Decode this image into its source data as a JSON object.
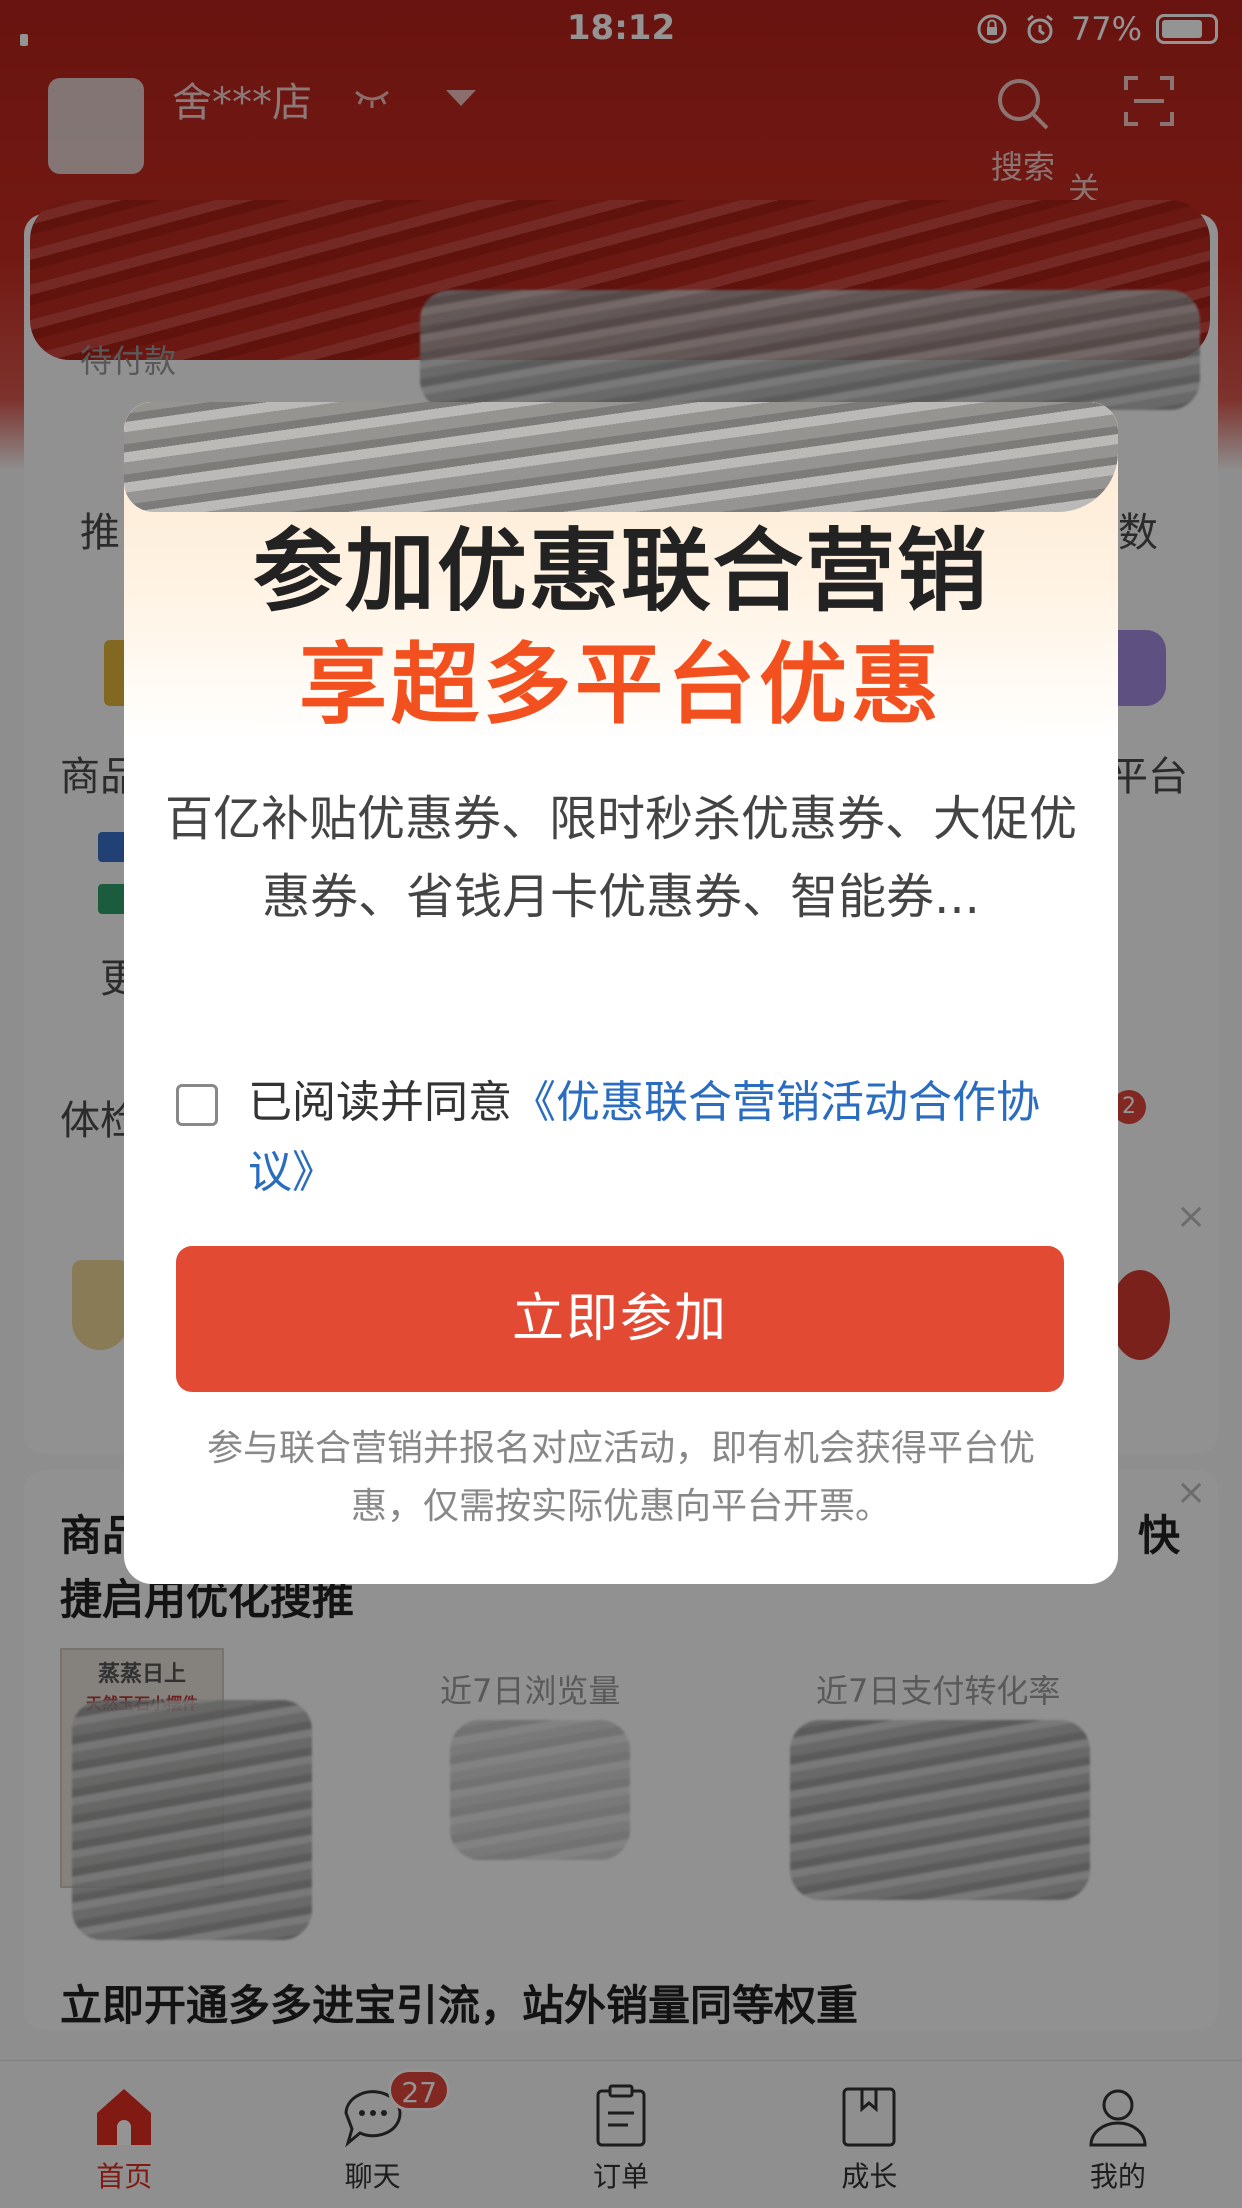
{
  "status_bar": {
    "time": "18:12",
    "battery": "77%"
  },
  "header": {
    "store_name": "舍***店",
    "search_label": "搜索",
    "scan_label": "关"
  },
  "background": {
    "pending_label": "待付款",
    "left_label_1": "推",
    "right_label_1": "数",
    "left_label_2": "商品",
    "right_label_2": "平台",
    "left_label_3": "更",
    "left_label_4": "体检",
    "badge_count": "2",
    "feature_title": "商品... 快捷启用优化搜推",
    "feature_title_line2": "捷启用优化搜推",
    "feature_title_right": "快",
    "metric_1_label": "近7日浏览量",
    "metric_2_label": "近7日支付转化率",
    "thumb_text_1": "蒸蒸日上",
    "thumb_text_2": "天然玉石小摆件",
    "promo_line": "立即开通多多进宝引流，站外销量同等权重"
  },
  "modal": {
    "title": "参加优惠联合营销",
    "subtitle": "享超多平台优惠",
    "description": "百亿补贴优惠券、限时秒杀优惠券、大促优惠券、省钱月卡优惠券、智能券...",
    "agree_prefix": "已阅读并同意",
    "agree_link": "《优惠联合营销活动合作协议》",
    "join_button": "立即参加",
    "note": "参与联合营销并报名对应活动，即有机会获得平台优惠，仅需按实际优惠向平台开票。"
  },
  "bottom_nav": {
    "items": [
      {
        "label": "首页",
        "icon": "home-icon",
        "active": true
      },
      {
        "label": "聊天",
        "icon": "chat-icon",
        "badge": "27"
      },
      {
        "label": "订单",
        "icon": "order-icon"
      },
      {
        "label": "成长",
        "icon": "growth-icon"
      },
      {
        "label": "我的",
        "icon": "profile-icon"
      }
    ]
  },
  "colors": {
    "brand_red": "#e02e24",
    "header_red": "#c72c22",
    "button_red": "#e24a33",
    "subtitle_orange": "#f2501e",
    "link_blue": "#2a6cbf"
  }
}
